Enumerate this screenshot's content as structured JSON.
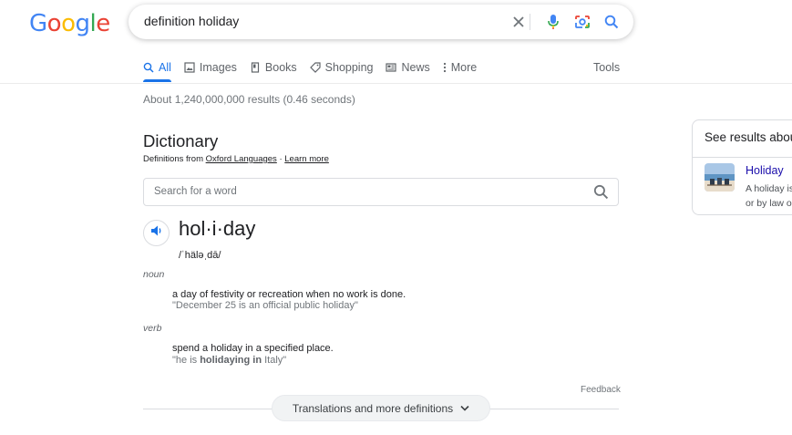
{
  "logo": {
    "letters": [
      "G",
      "o",
      "o",
      "g",
      "l",
      "e"
    ],
    "colors": [
      "#4285f4",
      "#ea4335",
      "#fbbc05",
      "#4285f4",
      "#34a853",
      "#ea4335"
    ]
  },
  "search": {
    "query": "definition holiday",
    "icons": [
      "close-icon",
      "mic-icon",
      "camera-icon",
      "search-icon"
    ]
  },
  "tabs": [
    {
      "label": "All",
      "icon": "search-icon",
      "active": true
    },
    {
      "label": "Images",
      "icon": "image-icon"
    },
    {
      "label": "Books",
      "icon": "book-icon"
    },
    {
      "label": "Shopping",
      "icon": "tag-icon"
    },
    {
      "label": "News",
      "icon": "news-icon"
    },
    {
      "label": "More",
      "icon": "more-vert-icon"
    }
  ],
  "tools_label": "Tools",
  "result_stats": "About 1,240,000,000 results (0.46 seconds)",
  "dictionary": {
    "title": "Dictionary",
    "source_prefix": "Definitions from ",
    "source_link": "Oxford Languages",
    "separator": " · ",
    "learn_more": "Learn more",
    "search_placeholder": "Search for a word",
    "headword": "hol·i·day",
    "phonetic": "/ˈhäləˌdā/",
    "entries": [
      {
        "pos": "noun",
        "definition": "a day of festivity or recreation when no work is done.",
        "example": "\"December 25 is an official public holiday\""
      },
      {
        "pos": "verb",
        "definition": "spend a holiday in a specified place.",
        "example_prefix": "\"he is ",
        "example_bold": "holidaying in",
        "example_suffix": " Italy\""
      }
    ],
    "feedback": "Feedback",
    "more_button": "Translations and more definitions"
  },
  "side_panel": {
    "heading": "See results about",
    "link": "Holiday",
    "snippet_line1": "A holiday is a day set aside",
    "snippet_line2": "or by law or custom"
  },
  "colors": {
    "accent": "#1a73e8",
    "link": "#1a0dab"
  }
}
